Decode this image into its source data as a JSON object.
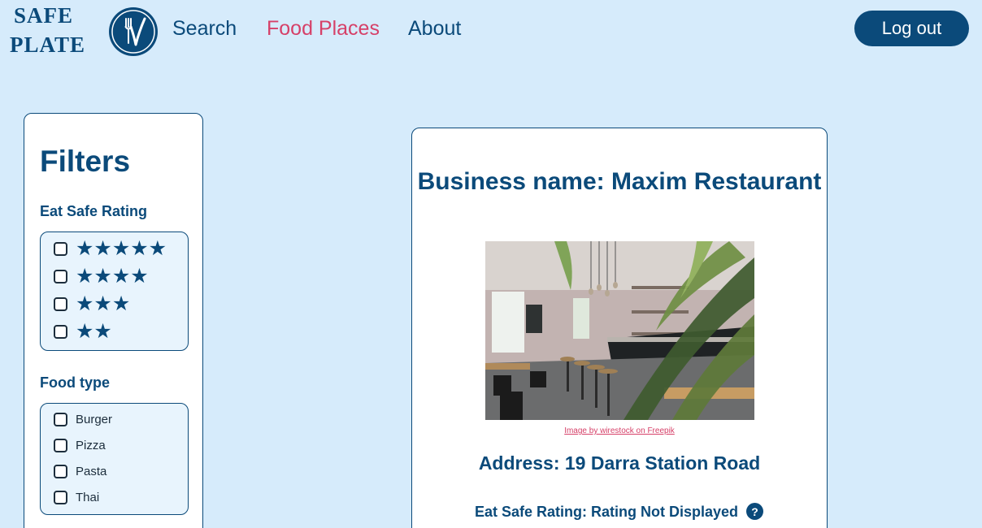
{
  "brand": {
    "line1": "SAFE",
    "line2": "PLATE"
  },
  "nav": {
    "search": "Search",
    "food_places": "Food Places",
    "about": "About",
    "active": "Food Places"
  },
  "header": {
    "logout_label": "Log out"
  },
  "filters": {
    "title": "Filters",
    "rating_label": "Eat Safe Rating",
    "rating_options": [
      {
        "stars": "★★★★★",
        "count": 5
      },
      {
        "stars": "★★★★",
        "count": 4
      },
      {
        "stars": "★★★",
        "count": 3
      },
      {
        "stars": "★★",
        "count": 2
      }
    ],
    "food_type_label": "Food type",
    "food_types": [
      "Burger",
      "Pizza",
      "Pasta",
      "Thai"
    ]
  },
  "business": {
    "title": "Business name: Maxim Restaurant",
    "image_credit": "Image by wirestock on Freepik",
    "address": "Address: 19 Darra Station Road",
    "rating_text": "Eat Safe Rating: Rating Not Displayed"
  },
  "icons": {
    "logo": "fork-check-icon",
    "help": "question-circle-icon"
  },
  "colors": {
    "brand": "#0b4a7a",
    "background": "#d6ebfb",
    "active_nav": "#d64068",
    "credit_link": "#d64068"
  }
}
